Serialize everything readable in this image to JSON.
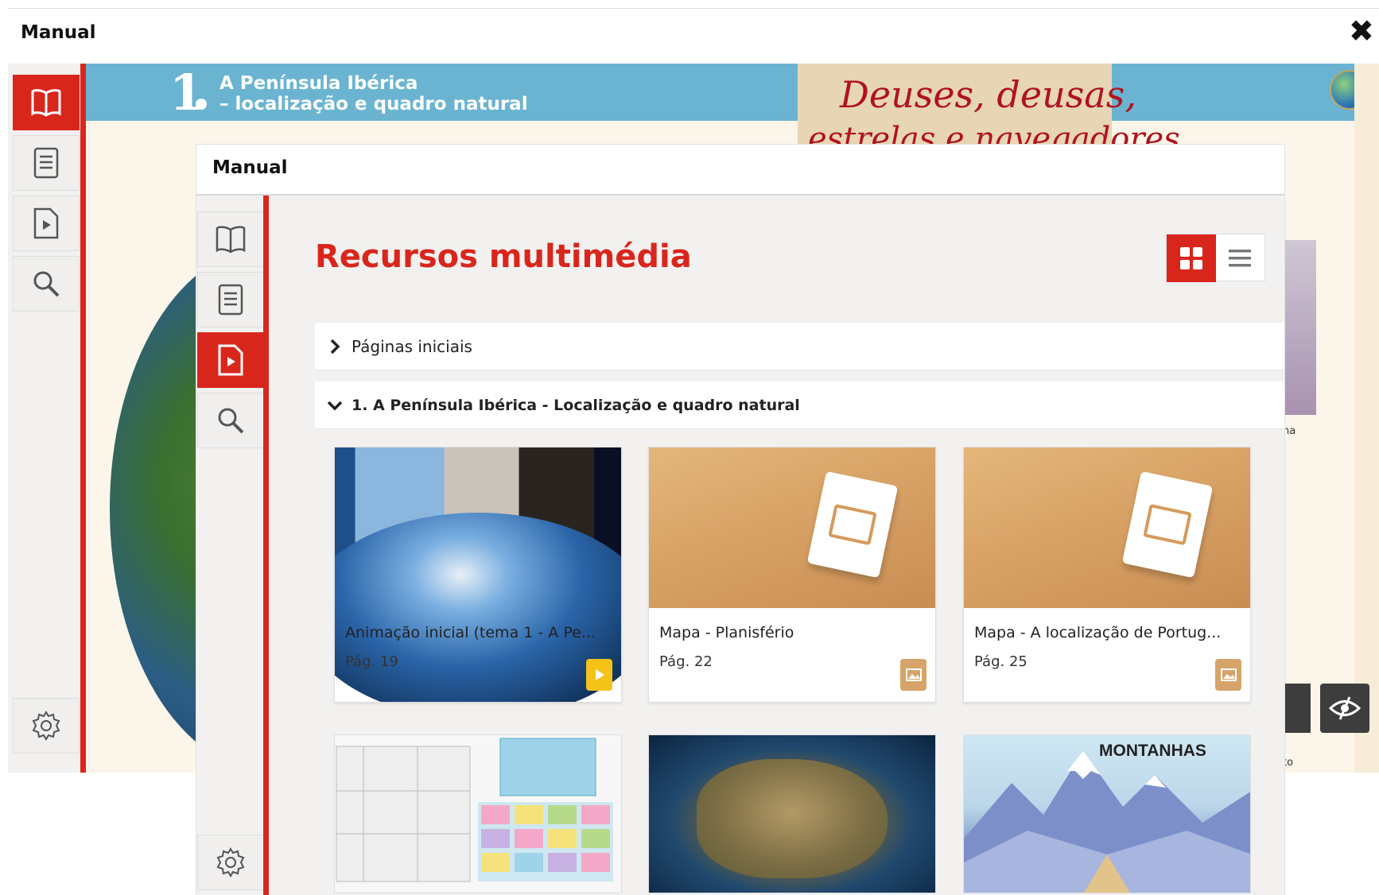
{
  "background_window": {
    "title": "Manual",
    "close_glyph": "✖",
    "sidebar": [
      {
        "icon": "book-icon",
        "active": true
      },
      {
        "icon": "list-icon",
        "active": false
      },
      {
        "icon": "media-file-icon",
        "active": false
      },
      {
        "icon": "search-icon",
        "active": false
      },
      {
        "icon": "gear-icon",
        "active": false
      }
    ],
    "page": {
      "chapter_number": "1",
      "chapter_title_line1": "A Península Ibérica",
      "chapter_title_line2": "– localização e quadro natural",
      "banner_line1": "Deuses, deusas,",
      "banner_line2": "estrelas e navegadores",
      "side_text1": "ha",
      "side_text2": "to"
    }
  },
  "modal": {
    "title": "Manual",
    "sidebar": [
      {
        "icon": "book-icon",
        "active": false
      },
      {
        "icon": "list-icon",
        "active": false
      },
      {
        "icon": "media-file-icon",
        "active": true
      },
      {
        "icon": "search-icon",
        "active": false
      },
      {
        "icon": "gear-icon",
        "active": false
      }
    ],
    "section_title": "Recursos multimédia",
    "view_modes": [
      "grid-view-icon",
      "list-view-icon"
    ],
    "accordion": [
      {
        "label": "Páginas iniciais",
        "expanded": false
      },
      {
        "label": "1. A Península Ibérica - Localização e quadro natural",
        "expanded": true
      }
    ],
    "cards": [
      {
        "title": "Animação inicial (tema 1 - A Pe...",
        "page": "Pág. 19",
        "type_icon": "play-icon",
        "type_color": "#f5c218"
      },
      {
        "title": "Mapa - Planisfério",
        "page": "Pág. 22",
        "type_icon": "image-icon",
        "type_color": "#d6a468"
      },
      {
        "title": "Mapa - A localização de Portug...",
        "page": "Pág. 25",
        "type_icon": "image-icon",
        "type_color": "#d6a468"
      }
    ],
    "second_row_thumb_text": "MONTANHAS"
  },
  "colors": {
    "accent_red": "#d9261c",
    "header_blue": "#6ab4d2",
    "panel_bg": "#f2f1ef"
  }
}
